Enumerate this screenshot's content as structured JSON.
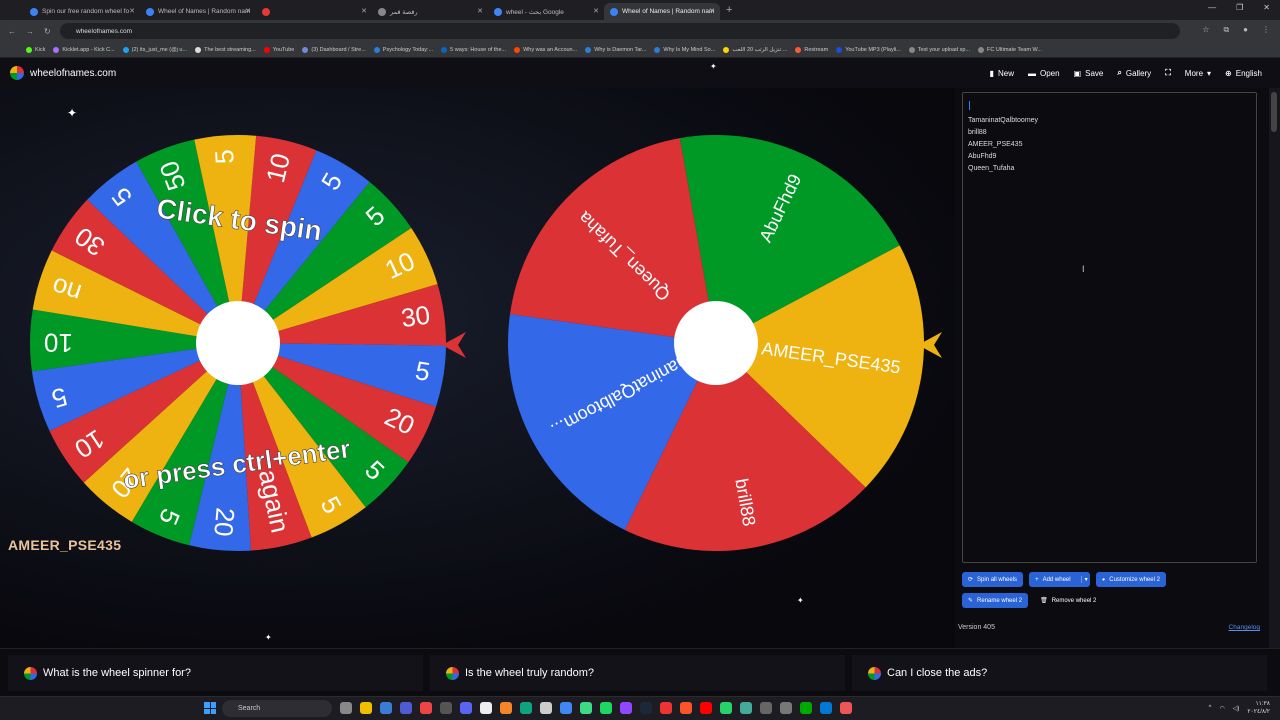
{
  "browser": {
    "tabs": [
      {
        "title": "Spin our free random wheel fo",
        "color": "#3b82f6"
      },
      {
        "title": "Wheel of Names | Random nam",
        "color": "#3b82f6"
      },
      {
        "title": "",
        "color": "#e53935"
      },
      {
        "title": "رقصة قمر",
        "color": "#888888"
      },
      {
        "title": "wheel - بحث Google",
        "color": "#4285f4"
      },
      {
        "title": "Wheel of Names | Random nam",
        "color": "#3b82f6"
      }
    ],
    "url": "wheelofnames.com",
    "bookmarks": [
      "Kick",
      "Kicklet.app - Kick C...",
      "(2) its_just_me (@j u...",
      "The best streaming...",
      "YouTube",
      "(3) Dashboard / Stre...",
      "Psychology Today:...",
      "5 ways: House of the...",
      "Why was an Accoun...",
      "Why is Daemon Tar...",
      "Why Is My Mind So...",
      "تنزيل الرتب 20 اللعب ...",
      "Restream",
      "YouTube MP3 (Playli...",
      "Test your upload sp...",
      "FC Ultimate Team W..."
    ]
  },
  "header": {
    "site": "wheelofnames.com",
    "menu": [
      "New",
      "Open",
      "Save",
      "Gallery",
      "",
      "More",
      "English"
    ]
  },
  "wheel1": {
    "segments": [
      "10",
      "5",
      "5",
      "10",
      "30",
      "5",
      "20",
      "5",
      "5",
      "again",
      "20",
      "5",
      "20",
      "10",
      "5",
      "10",
      "no",
      "30",
      "5",
      "50",
      "5"
    ],
    "colors": [
      "#db3236",
      "#3369e8",
      "#009925",
      "#eeb211",
      "#db3236",
      "#3369e8",
      "#db3236",
      "#009925",
      "#eeb211",
      "#db3236",
      "#3369e8",
      "#009925",
      "#eeb211",
      "#db3236",
      "#3369e8",
      "#009925",
      "#eeb211",
      "#db3236",
      "#3369e8",
      "#009925",
      "#eeb211"
    ],
    "overlay_top": "Click to spin",
    "overlay_bottom": "or press ctrl+enter"
  },
  "wheel2": {
    "segments": [
      "AbuFhd9",
      "AMEER_PSE435",
      "brill88",
      "TamaninatQalbtoom...",
      "Queen_Tufaha"
    ],
    "colors": [
      "#009925",
      "#eeb211",
      "#db3236",
      "#3369e8",
      "#db3236"
    ]
  },
  "floating_name": "AMEER_PSE435",
  "sidebar": {
    "entries": [
      "TamaninatQalbtoomey",
      "brill88",
      "AMEER_PSE435",
      "AbuFhd9",
      "Queen_Tufaha"
    ],
    "buttons_row1": [
      "Spin all wheels",
      "Add wheel",
      "Customize wheel 2"
    ],
    "buttons_row2": [
      "Rename wheel 2",
      "Remove wheel 2"
    ],
    "version": "Version 405",
    "changelog": "Changelog"
  },
  "faq": [
    "What is the wheel spinner for?",
    "Is the wheel truly random?",
    "Can I close the ads?"
  ],
  "taskbar": {
    "search": "Search",
    "clock_time": "١١:٣٨",
    "clock_date": "٢٠٢٤/٨/٢"
  }
}
